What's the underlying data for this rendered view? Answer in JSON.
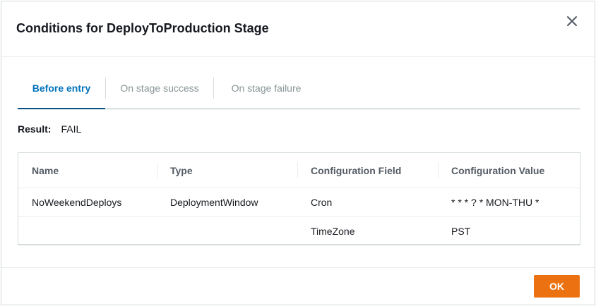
{
  "modal": {
    "title": "Conditions for DeployToProduction Stage",
    "close_icon": "close-icon"
  },
  "tabs": [
    {
      "label": "Before entry",
      "active": true
    },
    {
      "label": "On stage success",
      "active": false
    },
    {
      "label": "On stage failure",
      "active": false
    }
  ],
  "result": {
    "label": "Result:",
    "value": "FAIL"
  },
  "table": {
    "columns": [
      "Name",
      "Type",
      "Configuration Field",
      "Configuration Value"
    ],
    "rows": [
      [
        "NoWeekendDeploys",
        "DeploymentWindow",
        "Cron",
        "* * * ? * MON-THU *"
      ],
      [
        "",
        "",
        "TimeZone",
        "PST"
      ]
    ]
  },
  "footer": {
    "ok_label": "OK"
  },
  "colors": {
    "accent_tab": "#0073bb",
    "primary_button": "#ec7211"
  }
}
